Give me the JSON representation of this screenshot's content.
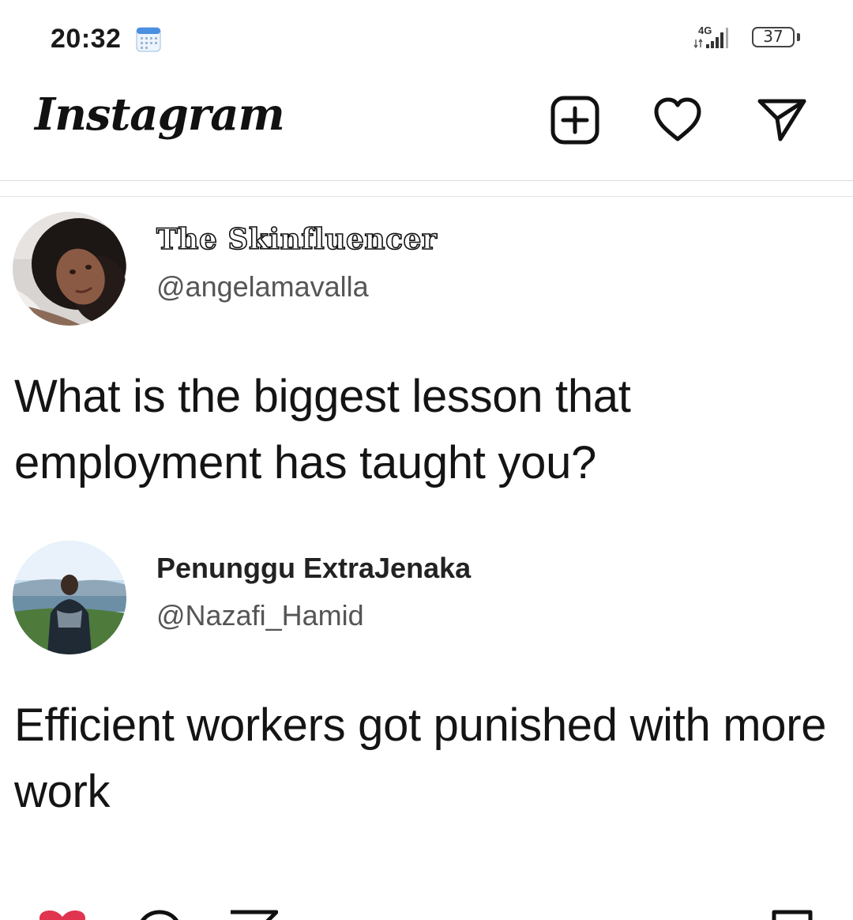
{
  "status_bar": {
    "time": "20:32",
    "network": "4G",
    "battery": "37"
  },
  "header": {
    "app_name": "Instagram",
    "icons": [
      "add-post-icon",
      "heart-icon",
      "direct-message-icon"
    ]
  },
  "post": {
    "tweets": [
      {
        "name": "The Skinfluencer",
        "handle": "@angelamavalla",
        "text": "What is the biggest lesson that employment has taught you?"
      },
      {
        "name": "Penunggu ExtraJenaka",
        "handle": "@Nazafi_Hamid",
        "text": "Efficient workers got punished with more work"
      }
    ],
    "actions": [
      "like-icon",
      "comment-icon",
      "share-icon",
      "save-icon"
    ]
  },
  "colors": {
    "like": "#e0344f",
    "text": "#141414",
    "handle": "#555555"
  }
}
